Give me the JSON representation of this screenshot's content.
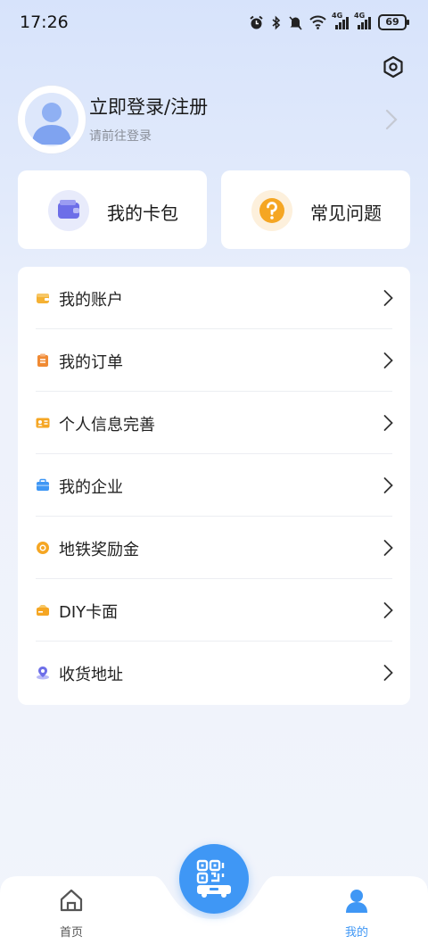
{
  "status_bar": {
    "time": "17:26",
    "icons": [
      "alarm-icon",
      "bluetooth-icon",
      "mute-icon",
      "wifi-icon",
      "signal-4g-icon",
      "signal-4g-icon"
    ],
    "network_label_1": "4G",
    "network_label_2": "4G",
    "battery": "69"
  },
  "header": {
    "settings_icon": "gear-icon",
    "login_title": "立即登录/注册",
    "login_subtitle": "请前往登录"
  },
  "quick_cards": [
    {
      "label": "我的卡包",
      "icon": "wallet-icon",
      "color": "#6d6ee8"
    },
    {
      "label": "常见问题",
      "icon": "question-icon",
      "color": "#f5a623"
    }
  ],
  "menu": {
    "items": [
      {
        "label": "我的账户",
        "icon": "account-icon",
        "color": "#f5b133"
      },
      {
        "label": "我的订单",
        "icon": "order-icon",
        "color": "#f08a33"
      },
      {
        "label": "个人信息完善",
        "icon": "id-card-icon",
        "color": "#f5a623"
      },
      {
        "label": "我的企业",
        "icon": "briefcase-icon",
        "color": "#3f97f5"
      },
      {
        "label": "地铁奖励金",
        "icon": "coin-icon",
        "color": "#f5a623"
      },
      {
        "label": "DIY卡面",
        "icon": "card-icon",
        "color": "#f5a623"
      },
      {
        "label": "收货地址",
        "icon": "location-icon",
        "color": "#6d6ee8"
      }
    ]
  },
  "tabbar": {
    "tabs": [
      {
        "label": "首页",
        "icon": "home-icon",
        "active": false
      },
      {
        "label": "我的",
        "icon": "user-icon",
        "active": true
      }
    ],
    "center_button_icon": "qr-bus-icon",
    "active_color": "#3f97f5",
    "inactive_color": "#555555"
  },
  "colors": {
    "accent": "#3f97f5",
    "background_top": "#d7e3fb",
    "background_bottom": "#f1f4fb"
  }
}
